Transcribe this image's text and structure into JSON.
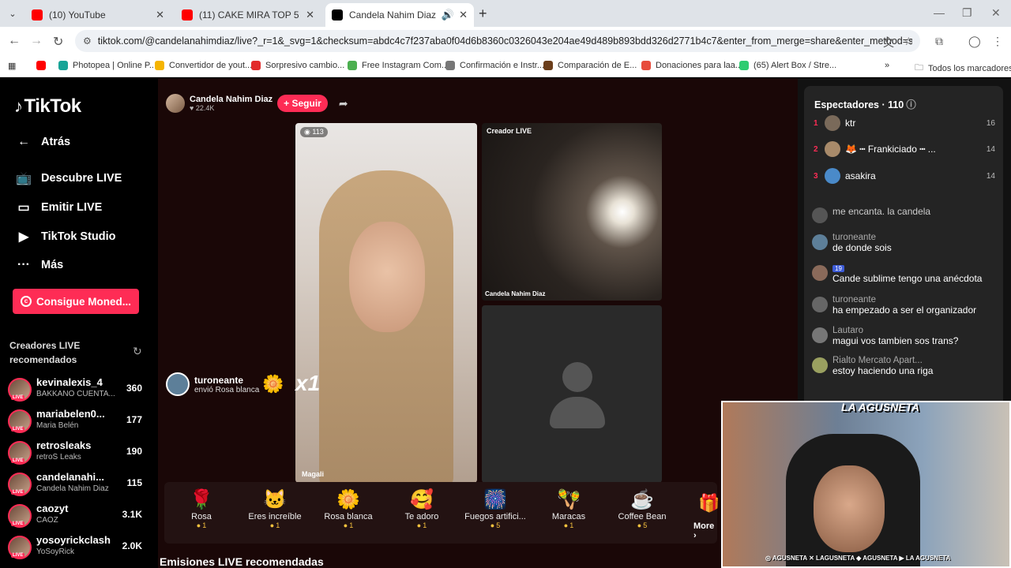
{
  "browser": {
    "tabs": [
      {
        "title": "(10) YouTube",
        "color": "#ff0000"
      },
      {
        "title": "(11) CAKE MIRA TOP 5 VÍDEOS",
        "color": "#ff0000"
      },
      {
        "title": "Candela Nahim Diaz (@can",
        "color": "#000000"
      }
    ],
    "url": "tiktok.com/@candelanahimdiaz/live?_r=1&_svg=1&checksum=abdc4c7f237aba0f04d6b8360c0326043e204ae49d489b893bdd326d2771b4c7&enter_from_merge=share&enter_method=share&sec_...",
    "bookmarks": [
      {
        "label": "",
        "color": "#ff0000"
      },
      {
        "label": "Photopea | Online P...",
        "color": "#18a497"
      },
      {
        "label": "Convertidor de yout...",
        "color": "#f5b400"
      },
      {
        "label": "Sorpresivo cambio...",
        "color": "#e22b2b"
      },
      {
        "label": "Free Instagram Com...",
        "color": "#4caf50"
      },
      {
        "label": "Confirmación e Instr...",
        "color": "#777777"
      },
      {
        "label": "Comparación de E...",
        "color": "#6b3e1b"
      },
      {
        "label": "Donaciones para laa...",
        "color": "#e74c3c"
      },
      {
        "label": "(65) Alert Box / Stre...",
        "color": "#2ecc71"
      }
    ],
    "all_bookmarks": "Todos los marcadores"
  },
  "nav": {
    "logo": "TikTok",
    "back": "Atrás",
    "items": [
      "Descubre LIVE",
      "Emitir LIVE",
      "TikTok Studio",
      "Más"
    ],
    "coins": "Consigue Moned...",
    "rec_title": "Creadores LIVE recomendados",
    "creators": [
      {
        "name": "kevinalexis_4",
        "sub": "BAKKANO CUENTA...",
        "count": "360"
      },
      {
        "name": "mariabelen0...",
        "sub": "Maria Belén",
        "count": "177"
      },
      {
        "name": "retrosleaks",
        "sub": "retroS Leaks",
        "count": "190"
      },
      {
        "name": "candelanahi...",
        "sub": "Candela Nahim Diaz",
        "count": "115"
      },
      {
        "name": "caozyt",
        "sub": "CAOZ",
        "count": "3.1K"
      },
      {
        "name": "yosoyrickclash",
        "sub": "YoSoyRick",
        "count": "2.0K"
      }
    ]
  },
  "stream": {
    "host": "Candela Nahim Diaz",
    "likes": "♥ 22.4K",
    "follow": "+ Seguir",
    "viewers_chip": "113",
    "main_label": "Magali",
    "creator_live": "Creador LIVE",
    "second_label": "Candela Nahim Diaz",
    "gift_user": "turoneante",
    "gift_text": "envió Rosa blanca",
    "gift_multiplier": "x1",
    "gifts": [
      {
        "icon": "🌹",
        "label": "Rosa",
        "price": "1"
      },
      {
        "icon": "🐱",
        "label": "Eres increíble",
        "price": "1"
      },
      {
        "icon": "🌼",
        "label": "Rosa blanca",
        "price": "1"
      },
      {
        "icon": "🥰",
        "label": "Te adoro",
        "price": "1"
      },
      {
        "icon": "🎆",
        "label": "Fuegos artifici...",
        "price": "5"
      },
      {
        "icon": "🪇",
        "label": "Maracas",
        "price": "1"
      },
      {
        "icon": "☕",
        "label": "Coffee Bean",
        "price": "5"
      }
    ],
    "more": "More ›",
    "rec_streams": "Emisiones LIVE recomendadas"
  },
  "chat": {
    "title": "Espectadores · 110",
    "ranking": [
      {
        "rank": "1",
        "name": "ktr",
        "points": "16",
        "color": "#7a6a5a"
      },
      {
        "rank": "2",
        "name": "🦊 ┅ Frankiciado ┅ ...",
        "points": "14",
        "color": "#a88a6a"
      },
      {
        "rank": "3",
        "name": "asakira",
        "points": "14",
        "color": "#4a8ac9"
      }
    ],
    "messages": [
      {
        "name": "",
        "text": "me encanta. la candela",
        "color": "#555555",
        "badge": ""
      },
      {
        "name": "turoneante",
        "text": "de donde sois",
        "color": "#5d7f99",
        "badge": ""
      },
      {
        "name": "",
        "text": "Cande sublime tengo una anécdota",
        "color": "#8a6a5a",
        "badge": "19"
      },
      {
        "name": "turoneante",
        "text": "ha empezado a ser el organizador",
        "color": "#666666",
        "badge": ""
      },
      {
        "name": "Lautaro",
        "text": "magui vos tambien sos trans?",
        "color": "#777777",
        "badge": ""
      },
      {
        "name": "Rialto Mercato Apart...",
        "text": "estoy haciendo una riga",
        "color": "#9aa060",
        "badge": ""
      }
    ]
  },
  "webcam": {
    "logo": "LA AGUSNETA",
    "bar": "◎ AGUSNETA  ✕ LAGUSNETA  ◆ AGUSNETA  ▶ LA AGUSNETA"
  }
}
